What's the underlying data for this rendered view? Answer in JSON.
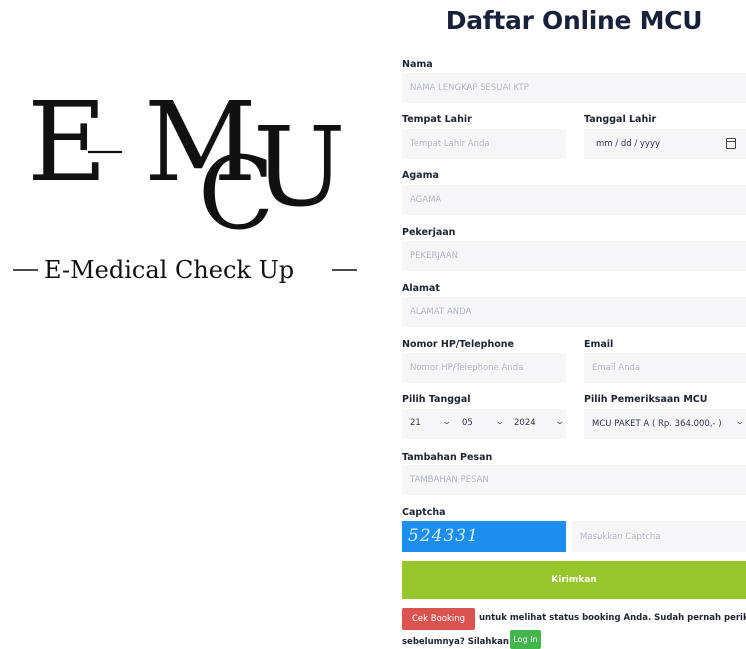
{
  "logo": {
    "e_letter": "E",
    "m_letter": "M",
    "c_letter": "C",
    "u_letter": "U",
    "tagline": "E-Medical Check Up"
  },
  "form": {
    "title": "Daftar Online MCU",
    "nama": {
      "label": "Nama",
      "placeholder": "NAMA LENGKAP SESUAI KTP"
    },
    "tempat_lahir": {
      "label": "Tempat Lahir",
      "placeholder": "Tempat Lahir Anda"
    },
    "tanggal_lahir": {
      "label": "Tanggal Lahir",
      "placeholder": "mm / dd / yyyy"
    },
    "agama": {
      "label": "Agama",
      "placeholder": "AGAMA"
    },
    "pekerjaan": {
      "label": "Pekerjaan",
      "placeholder": "PEKERJAAN"
    },
    "alamat": {
      "label": "Alamat",
      "placeholder": "ALAMAT ANDA"
    },
    "nomor_hp": {
      "label": "Nomor HP/Telephone",
      "placeholder": "Nomor HP/Telephone Anda"
    },
    "email": {
      "label": "Email",
      "placeholder": "Email Anda"
    },
    "pilih_tanggal": {
      "label": "Pilih Tanggal",
      "day": "21",
      "month": "05",
      "year": "2024"
    },
    "pemeriksaan": {
      "label": "Pilih Pemeriksaan MCU",
      "value": "MCU PAKET A ( Rp. 364.000,- )"
    },
    "tambahan": {
      "label": "Tambahan Pesan",
      "placeholder": "TAMBAHAN PESAN"
    },
    "captcha": {
      "label": "Captcha",
      "code": "524331",
      "placeholder": "Masukkan Captcha"
    },
    "submit_label": "Kirimkan"
  },
  "footer": {
    "cek_booking_label": "Cek Booking",
    "text_1": "untuk melihat status booking Anda. Sudah pernah periksa",
    "text_2": "sebelumnya? Silahkan",
    "login_label": "Log In"
  }
}
